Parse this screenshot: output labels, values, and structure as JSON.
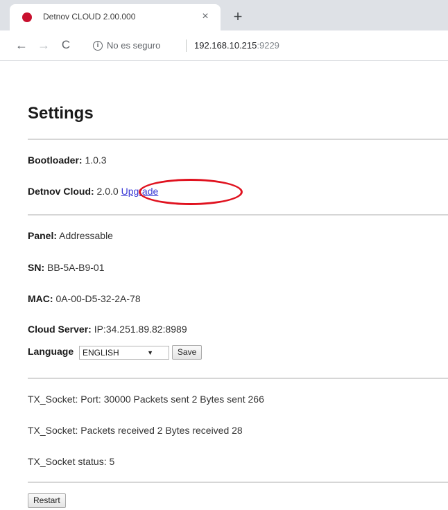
{
  "browser": {
    "tab_title": "Detnov CLOUD 2.00.000",
    "close_glyph": "×",
    "new_tab_glyph": "+",
    "back_glyph": "←",
    "forward_glyph": "→",
    "reload_glyph": "C",
    "info_glyph": "i",
    "security_text": "No es seguro",
    "url_host": "192.168.10.215",
    "url_port": ":9229"
  },
  "page": {
    "title": "Settings",
    "bootloader": {
      "label": "Bootloader:",
      "value": "1.0.3"
    },
    "cloud": {
      "label": "Detnov Cloud:",
      "value": "2.0.0",
      "upgrade_link": "Upgrade"
    },
    "panel": {
      "label": "Panel:",
      "value": "Addressable"
    },
    "sn": {
      "label": "SN:",
      "value": "BB-5A-B9-01"
    },
    "mac": {
      "label": "MAC:",
      "value": "0A-00-D5-32-2A-78"
    },
    "server": {
      "label": "Cloud Server:",
      "value": "IP:34.251.89.82:8989"
    },
    "language": {
      "label": "Language",
      "selected": "ENGLISH",
      "save_label": "Save"
    },
    "socket_lines": [
      "TX_Socket: Port: 30000 Packets sent 2 Bytes sent 266",
      "TX_Socket: Packets received 2 Bytes received 28",
      "TX_Socket status: 5"
    ],
    "restart_label": "Restart"
  },
  "colors": {
    "annotation": "#e0121f",
    "link": "#3b3bd6",
    "favicon": "#c8102e"
  },
  "icons": [
    "favicon-icon",
    "close-icon",
    "plus-icon",
    "back-arrow-icon",
    "forward-arrow-icon",
    "reload-icon",
    "info-icon",
    "chevron-down-icon"
  ]
}
